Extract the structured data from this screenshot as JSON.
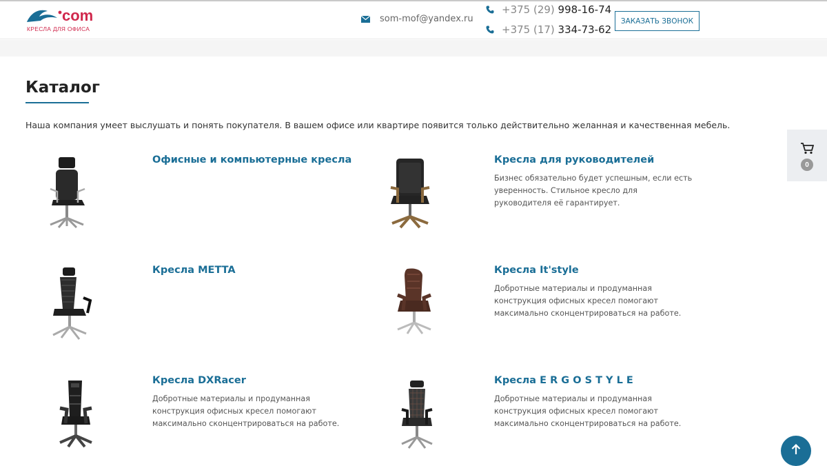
{
  "header": {
    "logo_text": "com",
    "logo_tagline": "кресла для офиса",
    "email": "som-mof@yandex.ru",
    "phones": [
      {
        "code": "+375 (29)",
        "number": "998-16-74"
      },
      {
        "code": "+375 (17)",
        "number": "334-73-62"
      }
    ],
    "callback_label": "Заказать звонок"
  },
  "page": {
    "title": "Каталог",
    "intro": "Наша компания умеет выслушать и понять покупателя. В вашем офисе или квартире появится только действительно желанная и качественная мебель."
  },
  "categories": [
    {
      "title": "Офисные и компьютерные кресла",
      "desc": ""
    },
    {
      "title": "Кресла для руководителей",
      "desc": "Бизнес обязательно будет успешным, если есть уверенность. Стильное кресло для руководителя её гарантирует."
    },
    {
      "title": "Кресла METTA",
      "desc": ""
    },
    {
      "title": "Кресла It'style",
      "desc": "Добротные материалы и продуманная конструкция офисных кресел помогают максимально сконцентрироваться на работе."
    },
    {
      "title": "Кресла DXRacer",
      "desc": "Добротные материалы и продуманная конструкция офисных кресел помогают максимально сконцентрироваться на работе."
    },
    {
      "title": "Кресла E R G O S T Y L E",
      "desc": "Добротные материалы и продуманная конструкция офисных кресел помогают максимально сконцентрироваться на работе."
    }
  ],
  "cart": {
    "count": "0"
  },
  "colors": {
    "accent": "#1a6e96",
    "brand_red": "#d0284c"
  }
}
